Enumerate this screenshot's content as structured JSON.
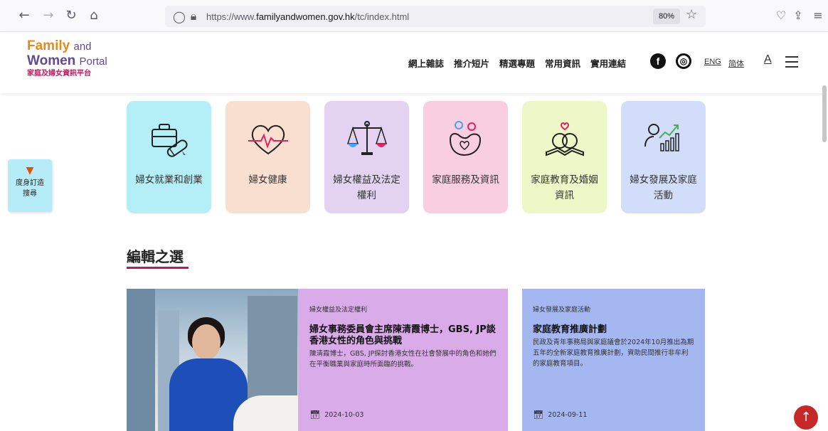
{
  "browser": {
    "url_prefix": "https://www.",
    "url_domain": "familyandwomen.gov.hk",
    "url_path": "/tc/index.html",
    "zoom": "80%"
  },
  "header": {
    "logo_family": "Family",
    "logo_and": "and",
    "logo_women": "Women",
    "logo_portal": "Portal",
    "logo_chinese": "家庭及婦女資訊平台",
    "nav": [
      "網上雜誌",
      "推介短片",
      "精選專題",
      "常用資訊",
      "實用連結"
    ],
    "lang_eng": "ENG",
    "lang_sc": "简体",
    "font_size_label": "A"
  },
  "filter": {
    "label": "度身訂造搜尋"
  },
  "categories": [
    {
      "label": "婦女就業和創業",
      "color": "#b4eef6",
      "icon": "briefcase-icon"
    },
    {
      "label": "婦女健康",
      "color": "#f9dfd0",
      "icon": "heartbeat-icon"
    },
    {
      "label": "婦女權益及法定權利",
      "color": "#e3d2f0",
      "icon": "scales-icon"
    },
    {
      "label": "家庭服務及資訊",
      "color": "#f9cfe0",
      "icon": "family-care-icon"
    },
    {
      "label": "家庭教育及婚姻資訊",
      "color": "#eef7c8",
      "icon": "rings-icon"
    },
    {
      "label": "婦女發展及家庭活動",
      "color": "#d2def9",
      "icon": "growth-chart-icon"
    }
  ],
  "section": {
    "title": "編輯之選"
  },
  "articles": [
    {
      "category": "婦女權益及法定權利",
      "headline": "婦女事務委員會主席陳清霞博士，GBS, JP談香港女性的角色與挑戰",
      "description": "陳清霞博士，GBS, JP探討香港女性在社會發展中的角色和她們在平衡職業與家庭時所面臨的挑戰。",
      "date": "2024-10-03"
    },
    {
      "category": "婦女發展及家庭活動",
      "headline": "家庭教育推廣計劃",
      "description": "民政及青年事務局與家庭議會於2024年10月推出為期五年的全新家庭教育推廣計劃，資助民間推行非牟利的家庭教育項目。",
      "date": "2024-09-11"
    }
  ]
}
